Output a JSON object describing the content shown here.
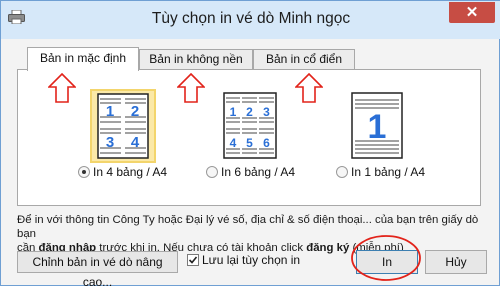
{
  "window": {
    "title": "Tùy chọn in vé dò Minh ngọc",
    "close_symbol": "✕"
  },
  "tabs": [
    {
      "label": "Bản in mặc định",
      "active": true
    },
    {
      "label": "Bản in không nền",
      "active": false
    },
    {
      "label": "Bản in cổ điển",
      "active": false
    }
  ],
  "layouts": [
    {
      "label": "In 4 bảng / A4",
      "selected": true,
      "numbers": [
        "1",
        "2",
        "3",
        "4"
      ]
    },
    {
      "label": "In 6 bảng / A4",
      "selected": false,
      "numbers": [
        "1",
        "2",
        "3",
        "4",
        "5",
        "6"
      ]
    },
    {
      "label": "In 1 bảng / A4",
      "selected": false,
      "numbers": [
        "1"
      ]
    }
  ],
  "info": {
    "line1": "Để in với thông tin Công Ty hoặc Đại lý vé số, địa chỉ & số điện thoại... của bạn trên giấy dò bạn",
    "line2_pre": "cần ",
    "line2_bold1": "đăng nhập",
    "line2_mid": " trước khi in. Nếu chưa có tài khoản click ",
    "line2_bold2": "đăng ký",
    "line2_post": " (miễn phí)"
  },
  "footer": {
    "advanced_button": "Chỉnh bản in vé dò nâng cao...",
    "remember_label": "Lưu lại tùy chọn in",
    "remember_checked": true,
    "print_button": "In",
    "cancel_button": "Hủy"
  },
  "colors": {
    "annotation_red": "#e2231a",
    "selected_frame": "#f3d56c",
    "number_blue": "#2a6fd6",
    "close_red": "#c74d44"
  }
}
